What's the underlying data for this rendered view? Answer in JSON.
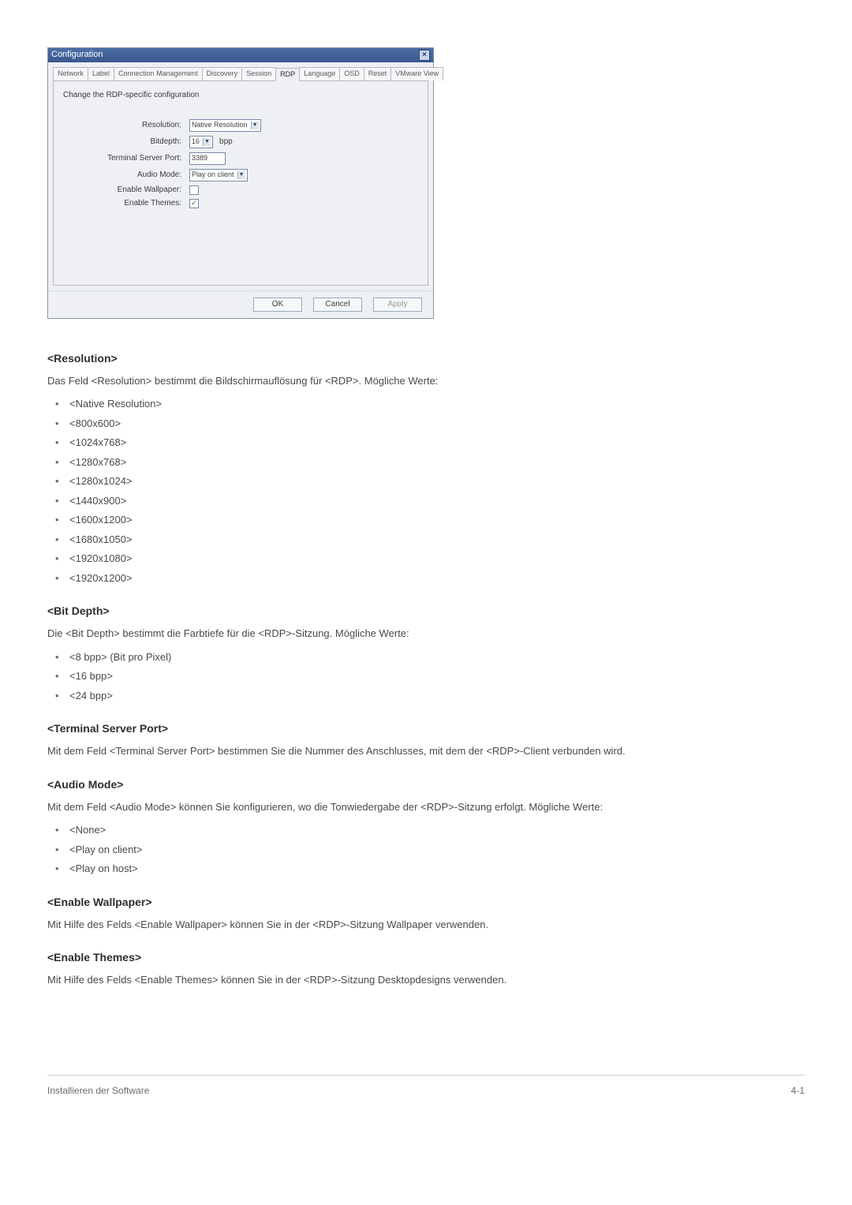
{
  "dialog": {
    "title": "Configuration",
    "tabs": [
      "Network",
      "Label",
      "Connection Management",
      "Discovery",
      "Session",
      "RDP",
      "Language",
      "OSD",
      "Reset",
      "VMware View"
    ],
    "active_tab_index": 5,
    "intro": "Change the RDP-specific configuration",
    "fields": {
      "resolution_label": "Resolution:",
      "resolution_value": "Native Resolution",
      "bitdepth_label": "Bitdepth:",
      "bitdepth_value": "16",
      "bitdepth_unit": "bpp",
      "port_label": "Terminal Server Port:",
      "port_value": "3389",
      "audio_label": "Audio Mode:",
      "audio_value": "Play on client",
      "wallpaper_label": "Enable Wallpaper:",
      "wallpaper_checked": false,
      "themes_label": "Enable Themes:",
      "themes_checked": true
    },
    "buttons": {
      "ok": "OK",
      "cancel": "Cancel",
      "apply": "Apply"
    }
  },
  "sections": {
    "resolution": {
      "heading": "<Resolution>",
      "para": "Das Feld <Resolution> bestimmt die Bildschirmauflösung für <RDP>. Mögliche Werte:",
      "items": [
        "<Native Resolution>",
        "<800x600>",
        "<1024x768>",
        "<1280x768>",
        "<1280x1024>",
        "<1440x900>",
        "<1600x1200>",
        "<1680x1050>",
        "<1920x1080>",
        "<1920x1200>"
      ]
    },
    "bitdepth": {
      "heading": "<Bit Depth>",
      "para": "Die <Bit Depth> bestimmt die Farbtiefe für die <RDP>-Sitzung. Mögliche Werte:",
      "items": [
        "<8 bpp> (Bit pro Pixel)",
        "<16 bpp>",
        "<24 bpp>"
      ]
    },
    "port": {
      "heading": "<Terminal Server Port>",
      "para": "Mit dem Feld <Terminal Server Port> bestimmen Sie die Nummer des Anschlusses, mit dem der <RDP>-Client verbunden wird."
    },
    "audio": {
      "heading": "<Audio Mode>",
      "para": "Mit dem Feld <Audio Mode> können Sie konfigurieren, wo die Tonwiedergabe der <RDP>-Sitzung erfolgt. Mögliche Werte:",
      "items": [
        "<None>",
        "<Play on client>",
        "<Play on host>"
      ]
    },
    "wallpaper": {
      "heading": "<Enable Wallpaper>",
      "para": "Mit Hilfe des Felds <Enable Wallpaper> können Sie in der <RDP>-Sitzung Wallpaper verwenden."
    },
    "themes": {
      "heading": "<Enable Themes>",
      "para": "Mit Hilfe des Felds <Enable Themes> können Sie in der <RDP>-Sitzung Desktopdesigns verwenden."
    }
  },
  "footer": {
    "left": "Installieren der Software",
    "right": "4-1"
  }
}
